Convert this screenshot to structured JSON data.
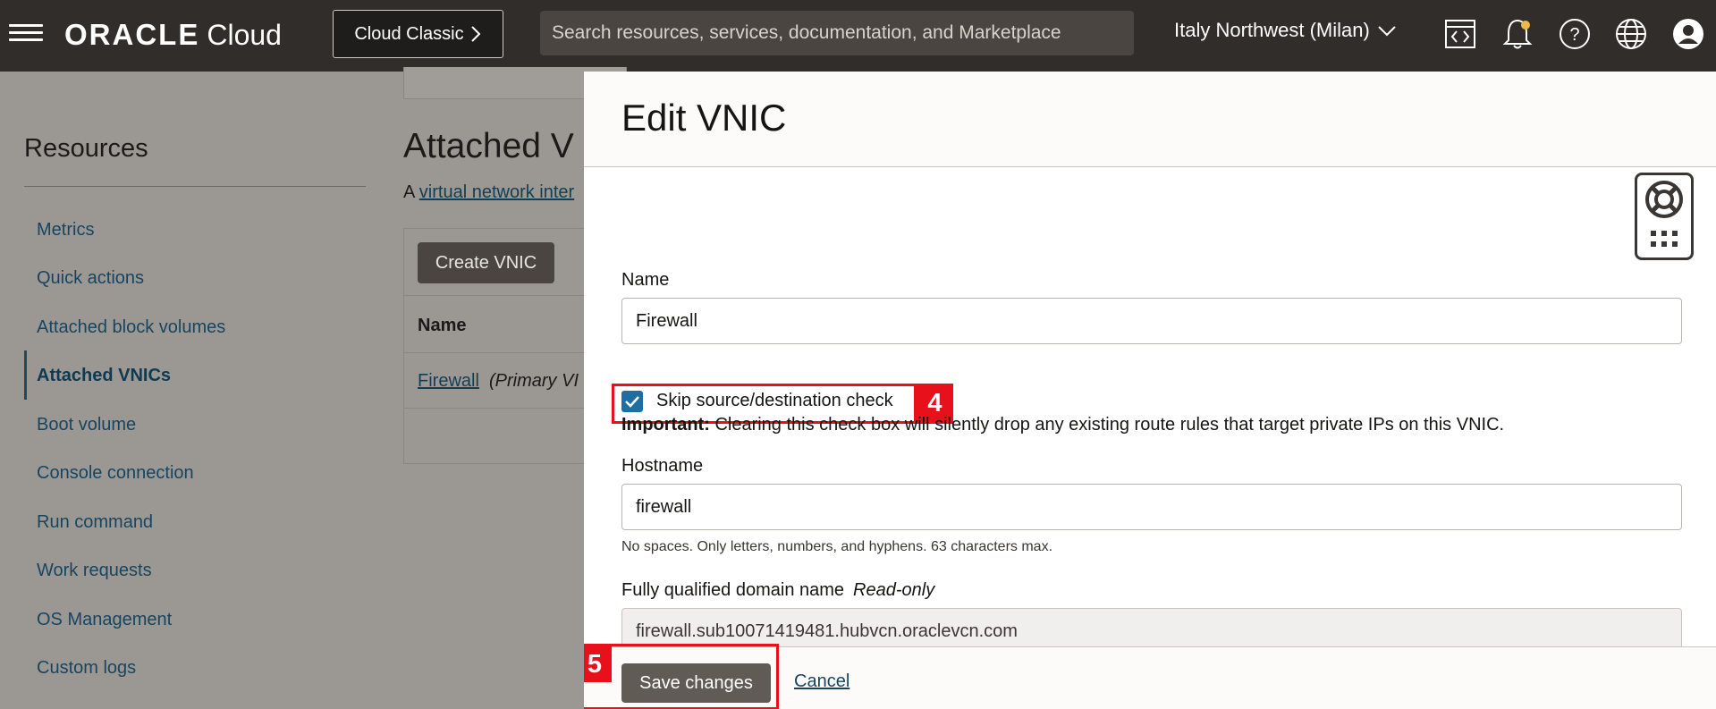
{
  "header": {
    "brand_oracle": "ORACLE",
    "brand_cloud": "Cloud",
    "cloud_classic_label": "Cloud Classic",
    "search_placeholder": "Search resources, services, documentation, and Marketplace",
    "region": "Italy Northwest (Milan)"
  },
  "sidebar": {
    "title": "Resources",
    "items": [
      {
        "label": "Metrics"
      },
      {
        "label": "Quick actions"
      },
      {
        "label": "Attached block volumes"
      },
      {
        "label": "Attached VNICs"
      },
      {
        "label": "Boot volume"
      },
      {
        "label": "Console connection"
      },
      {
        "label": "Run command"
      },
      {
        "label": "Work requests"
      },
      {
        "label": "OS Management"
      },
      {
        "label": "Custom logs"
      }
    ]
  },
  "main": {
    "title": "Attached V",
    "desc_prefix": "A ",
    "desc_link": "virtual network inter",
    "create_button": "Create VNIC",
    "column_name": "Name",
    "row_link": "Firewall",
    "row_extra": "(Primary VI"
  },
  "panel": {
    "title": "Edit VNIC",
    "name_label": "Name",
    "name_value": "Firewall",
    "checkbox_label": "Skip source/destination check",
    "step4": "4",
    "important_bold": "Important:",
    "important_text": " Clearing this check box will silently drop any existing route rules that target private IPs on this VNIC.",
    "hostname_label": "Hostname",
    "hostname_value": "firewall",
    "hostname_hint": "No spaces. Only letters, numbers, and hyphens. 63 characters max.",
    "fqdn_label": "Fully qualified domain name",
    "fqdn_readonly": "Read-only",
    "fqdn_value": "firewall.sub10071419481.hubvcn.oraclevcn.com",
    "step5": "5",
    "save_label": "Save changes",
    "cancel_label": "Cancel"
  }
}
